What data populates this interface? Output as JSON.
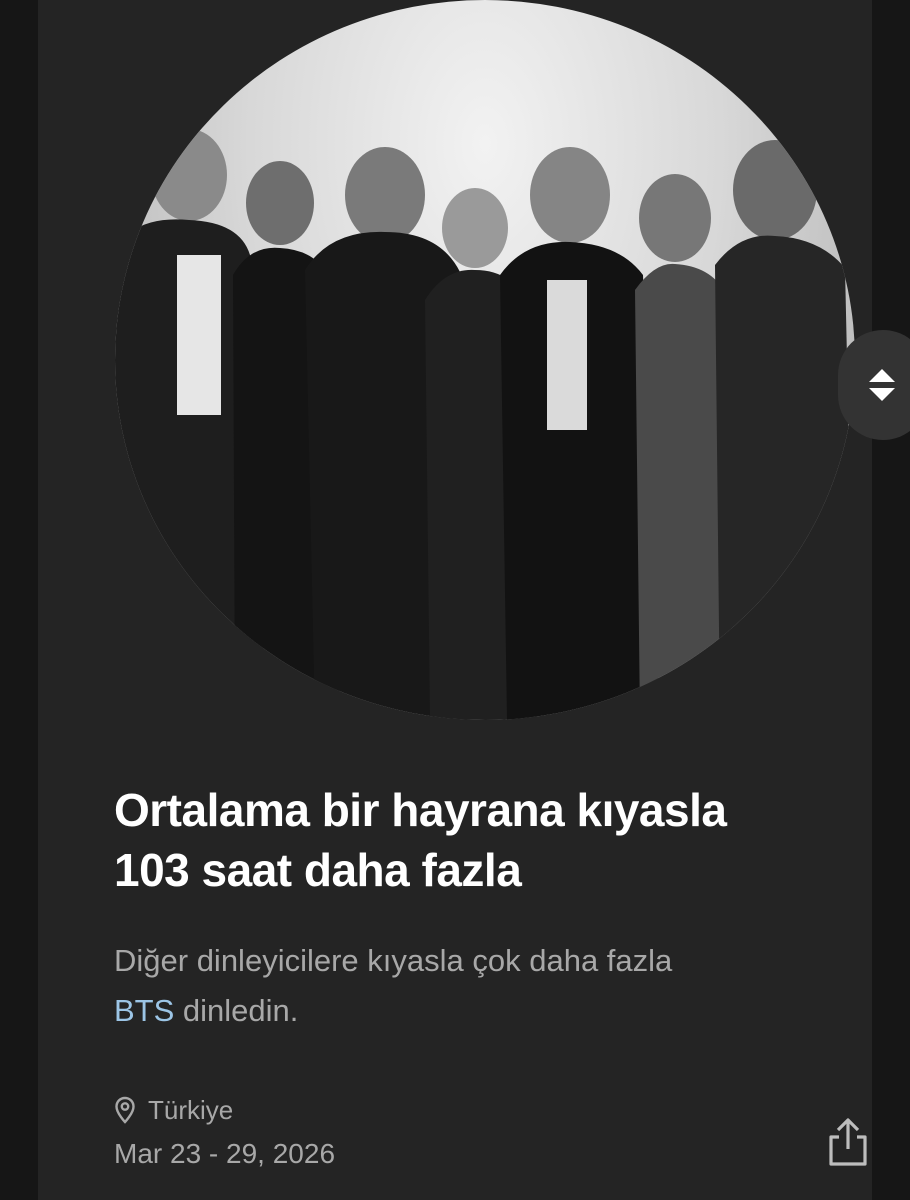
{
  "artist": {
    "name": "BTS",
    "image_alt": "BTS group photo"
  },
  "headline": {
    "line1": "Ortalama bir hayrana kıyasla",
    "line2": "103 saat daha fazla"
  },
  "subtext": {
    "before": "Diğer dinleyicilere kıyasla çok daha fazla",
    "artist": "BTS",
    "after": " dinledin."
  },
  "location": {
    "icon": "location-pin-icon",
    "label": "Türkiye"
  },
  "date_range": "Mar 23 - 29, 2026",
  "share": {
    "icon": "share-icon"
  },
  "scroll_handle": {
    "icon": "up-down-arrows-icon"
  },
  "colors": {
    "background": "#161616",
    "card": "#242424",
    "headline": "#ffffff",
    "secondary_text": "#a8a8a8",
    "artist_link": "#9cc5e6"
  }
}
